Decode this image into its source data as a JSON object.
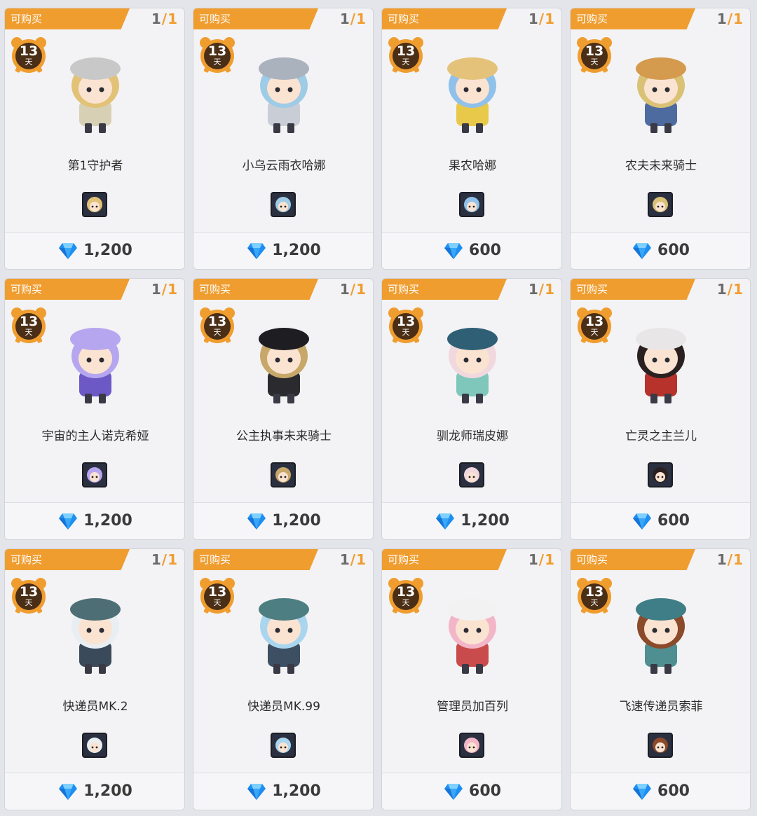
{
  "shop": {
    "items": [
      {
        "status": "可购买",
        "stock": "1",
        "limit": "1",
        "days": "13",
        "day_unit": "天",
        "name": "第1守护者",
        "price": "1,200",
        "hair": "#e2c277",
        "outfit": "#d7d0b5",
        "hat": "#c8c8c8"
      },
      {
        "status": "可购买",
        "stock": "1",
        "limit": "1",
        "days": "13",
        "day_unit": "天",
        "name": "小乌云雨衣哈娜",
        "price": "1,200",
        "hair": "#9ecbe6",
        "outfit": "#c9ced6",
        "hat": "#aab2bd"
      },
      {
        "status": "可购买",
        "stock": "1",
        "limit": "1",
        "days": "13",
        "day_unit": "天",
        "name": "果农哈娜",
        "price": "600",
        "hair": "#8fc1ea",
        "outfit": "#e9c94a",
        "hat": "#e4c27a"
      },
      {
        "status": "可购买",
        "stock": "1",
        "limit": "1",
        "days": "13",
        "day_unit": "天",
        "name": "农夫未来骑士",
        "price": "600",
        "hair": "#d9c276",
        "outfit": "#4d6b9e",
        "hat": "#d49a4e"
      },
      {
        "status": "可购买",
        "stock": "1",
        "limit": "1",
        "days": "13",
        "day_unit": "天",
        "name": "宇宙的主人诺克希娅",
        "price": "1,200",
        "hair": "#b6a6f0",
        "outfit": "#6c59c5",
        "hat": "#b6a6f0"
      },
      {
        "status": "可购买",
        "stock": "1",
        "limit": "1",
        "days": "13",
        "day_unit": "天",
        "name": "公主执事未来骑士",
        "price": "1,200",
        "hair": "#c7a86a",
        "outfit": "#2a2a2f",
        "hat": "#1e1e22"
      },
      {
        "status": "可购买",
        "stock": "1",
        "limit": "1",
        "days": "13",
        "day_unit": "天",
        "name": "驯龙师瑞皮娜",
        "price": "1,200",
        "hair": "#f1d8de",
        "outfit": "#7fc7bb",
        "hat": "#2f5f75"
      },
      {
        "status": "可购买",
        "stock": "1",
        "limit": "1",
        "days": "13",
        "day_unit": "天",
        "name": "亡灵之主兰儿",
        "price": "600",
        "hair": "#2b2020",
        "outfit": "#b8322c",
        "hat": "#e8e6e6"
      },
      {
        "status": "可购买",
        "stock": "1",
        "limit": "1",
        "days": "13",
        "day_unit": "天",
        "name": "快递员MK.2",
        "price": "1,200",
        "hair": "#e8eef2",
        "outfit": "#3a4a5a",
        "hat": "#4d6e75"
      },
      {
        "status": "可购买",
        "stock": "1",
        "limit": "1",
        "days": "13",
        "day_unit": "天",
        "name": "快递员MK.99",
        "price": "1,200",
        "hair": "#a9d6ee",
        "outfit": "#3c4f63",
        "hat": "#4d7e82"
      },
      {
        "status": "可购买",
        "stock": "1",
        "limit": "1",
        "days": "13",
        "day_unit": "天",
        "name": "管理员加百列",
        "price": "600",
        "hair": "#f2b6c8",
        "outfit": "#c94b4b",
        "hat": "#f2f2f2"
      },
      {
        "status": "可购买",
        "stock": "1",
        "limit": "1",
        "days": "13",
        "day_unit": "天",
        "name": "飞速传递员索菲",
        "price": "600",
        "hair": "#8b4a2a",
        "outfit": "#4f8e91",
        "hat": "#3f7e86"
      }
    ],
    "icons": {
      "timer": "alarm-clock-icon",
      "currency": "diamond-gem-icon"
    },
    "colors": {
      "accent": "#f09d2f",
      "gem": "#1e8ef0",
      "card": "#f3f3f5"
    }
  }
}
